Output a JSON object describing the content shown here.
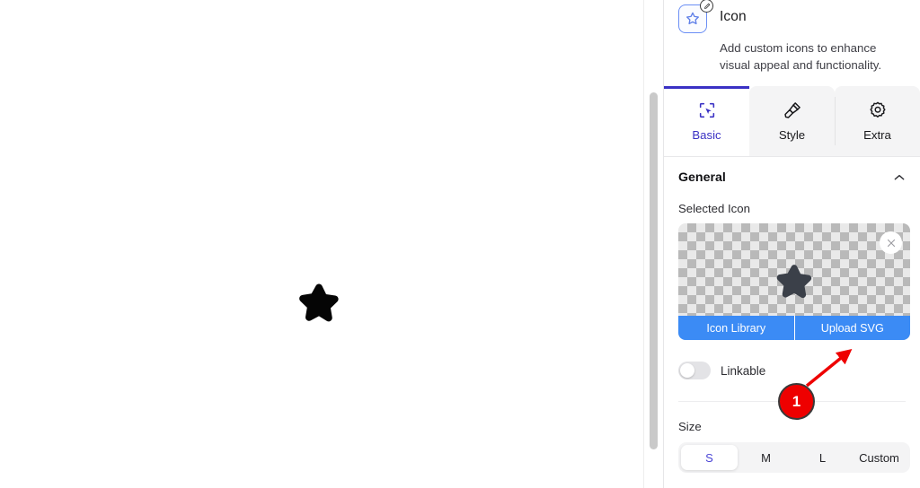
{
  "canvas": {
    "icon_name": "star-icon"
  },
  "panel": {
    "header": {
      "widget_icon": "star-in-square-icon",
      "badge_icon": "edit-badge-icon",
      "title": "Icon",
      "description": "Add custom icons to enhance visual appeal and functionality."
    },
    "tabs": [
      {
        "label": "Basic",
        "icon": "cursor-select-icon",
        "active": true
      },
      {
        "label": "Style",
        "icon": "paintbrush-icon",
        "active": false
      },
      {
        "label": "Extra",
        "icon": "gear-icon",
        "active": false
      }
    ],
    "general": {
      "title": "General",
      "collapse_icon": "chevron-up-icon",
      "selected_icon_label": "Selected Icon",
      "preview": {
        "icon": "star-icon",
        "close_icon": "close-icon",
        "buttons": [
          {
            "label": "Icon Library"
          },
          {
            "label": "Upload SVG"
          }
        ]
      },
      "linkable": {
        "label": "Linkable",
        "value": "off"
      }
    },
    "size": {
      "label": "Size",
      "options": [
        "S",
        "M",
        "L",
        "Custom"
      ],
      "selected": "S"
    }
  },
  "annotation": {
    "step_number": "1",
    "arrow": "red-arrow-pointing-to-upload-svg",
    "color": "#ee0000"
  },
  "colors": {
    "accent_blue": "#3b8bf5",
    "tab_active": "#3a31c4",
    "segment_active_text": "#4b46d6",
    "annotation_red": "#ee0000"
  }
}
